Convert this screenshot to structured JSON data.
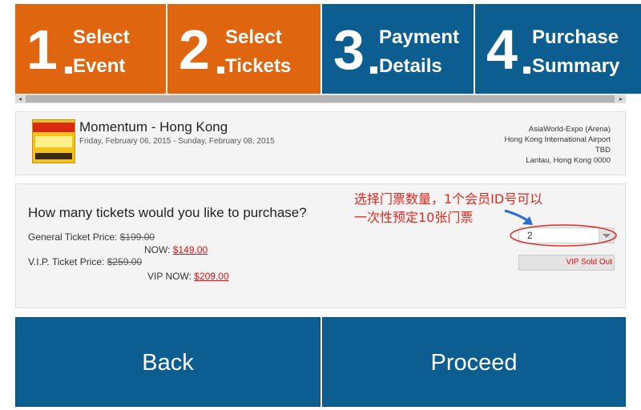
{
  "steps": [
    {
      "number": "1",
      "line1": "Select",
      "line2": "Event",
      "color": "#e0650f"
    },
    {
      "number": "2",
      "line1": "Select",
      "line2": "Tickets",
      "color": "#e0650f"
    },
    {
      "number": "3",
      "line1": "Payment",
      "line2": "Details",
      "color": "#0b5e8f"
    },
    {
      "number": "4",
      "line1": "Purchase",
      "line2": "Summary",
      "color": "#0b5e8f"
    }
  ],
  "scrollbar": {
    "left_arrow": "◂",
    "right_arrow": "▸"
  },
  "event": {
    "title": "Momentum - Hong Kong",
    "dates": "Friday, February 06, 2015 - Sunday, February 08, 2015",
    "venue": [
      "AsiaWorld-Expo (Arena)",
      "Hong Kong International Airport",
      "TBD",
      "Lantau, Hong Kong 0000"
    ]
  },
  "tickets": {
    "question": "How many tickets would you like to purchase?",
    "general_label": "General Ticket Price:",
    "general_old": "$199.00",
    "now_label": "NOW:",
    "general_now": "$149.00",
    "vip_label": "V.I.P. Ticket Price:",
    "vip_old": "$259.00",
    "vip_now_label": "VIP NOW:",
    "vip_now": "$209.00",
    "quantity_value": "2",
    "vip_status": "VIP Sold Out"
  },
  "annotation": {
    "line1": "选择门票数量，1个会员ID号可以",
    "line2": "一次性预定10张门票",
    "color": "#e0281e"
  },
  "buttons": {
    "back": "Back",
    "proceed": "Proceed",
    "color": "#0b5e8f"
  }
}
